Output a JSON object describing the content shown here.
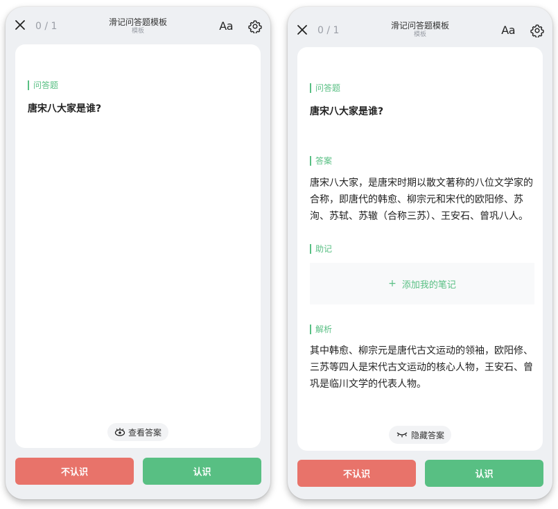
{
  "left_screen": {
    "counter": "0 / 1",
    "title": "滑记问答题模板",
    "subtitle": "模板",
    "font_button": "Aa",
    "question_label": "问答题",
    "question": "唐宋八大家是谁?",
    "toggle_label": "查看答案",
    "btn_unknown": "不认识",
    "btn_known": "认识"
  },
  "right_screen": {
    "counter": "0 / 1",
    "title": "滑记问答题模板",
    "subtitle": "模板",
    "font_button": "Aa",
    "question_label": "问答题",
    "question": "唐宋八大家是谁?",
    "answer_label": "答案",
    "answer_text": "唐宋八大家，是唐宋时期以散文著称的八位文学家的合称，即唐代的韩愈、柳宗元和宋代的欧阳修、苏洵、苏轼、苏辙（合称三苏）、王安石、曾巩八人。",
    "mnemonic_label": "助记",
    "add_note": "添加我的笔记",
    "analysis_label": "解析",
    "analysis_text": "其中韩愈、柳宗元是唐代古文运动的领袖，欧阳修、三苏等四人是宋代古文运动的核心人物，王安石、曾巩是临川文学的代表人物。",
    "toggle_label": "隐藏答案",
    "btn_unknown": "不认识",
    "btn_known": "认识"
  },
  "colors": {
    "accent_green": "#58bf83",
    "danger_red": "#e8736a",
    "background": "#eef0f3"
  }
}
